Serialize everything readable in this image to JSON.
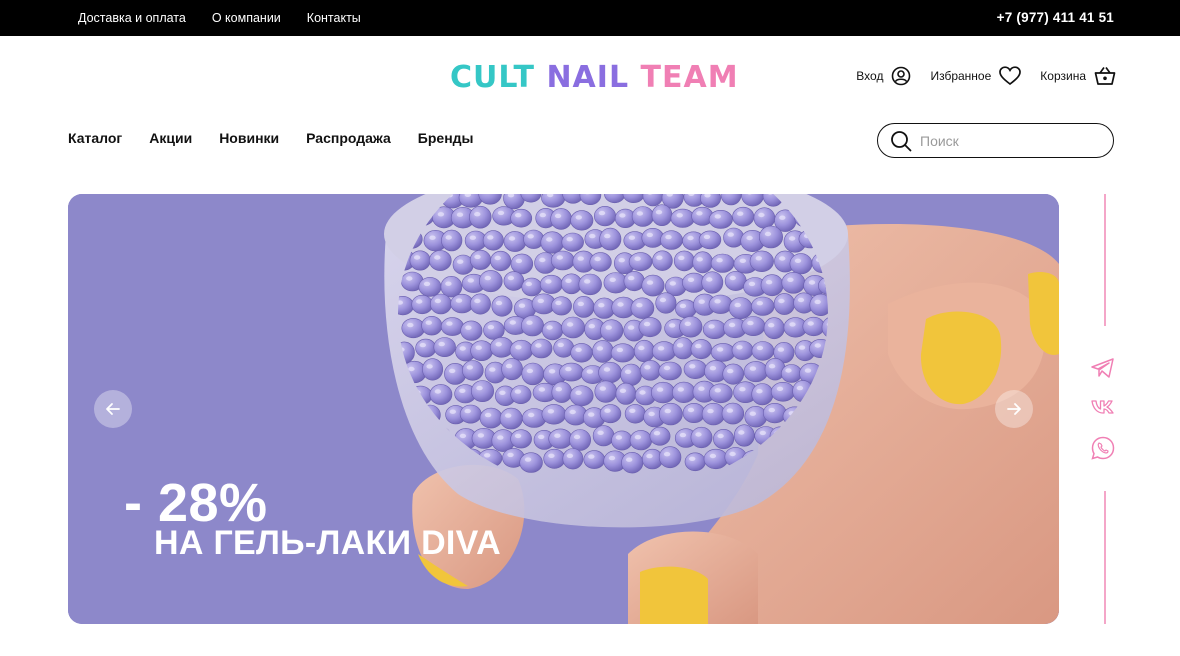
{
  "topbar": {
    "links": [
      "Доставка и оплата",
      "О компании",
      "Контакты"
    ],
    "phone": "+7 (977) 411 41 51"
  },
  "logo": {
    "word1": "CULT",
    "word2": "NAIL",
    "word3": "TEAM"
  },
  "user_actions": {
    "login": "Вход",
    "favorites": "Избранное",
    "cart": "Корзина"
  },
  "nav": {
    "items": [
      "Каталог",
      "Акции",
      "Новинки",
      "Распродажа",
      "Бренды"
    ]
  },
  "search": {
    "placeholder": "Поиск",
    "value": ""
  },
  "banner": {
    "discount": "- 28%",
    "subtitle": "НА ГЕЛЬ-ЛАКИ DIVA"
  },
  "social": [
    "telegram-icon",
    "vk-icon",
    "whatsapp-icon"
  ],
  "colors": {
    "accent_teal": "#35c7c6",
    "accent_purple": "#8a6ee0",
    "accent_pink": "#f07fb4",
    "banner_bg": "#8b86c8"
  }
}
